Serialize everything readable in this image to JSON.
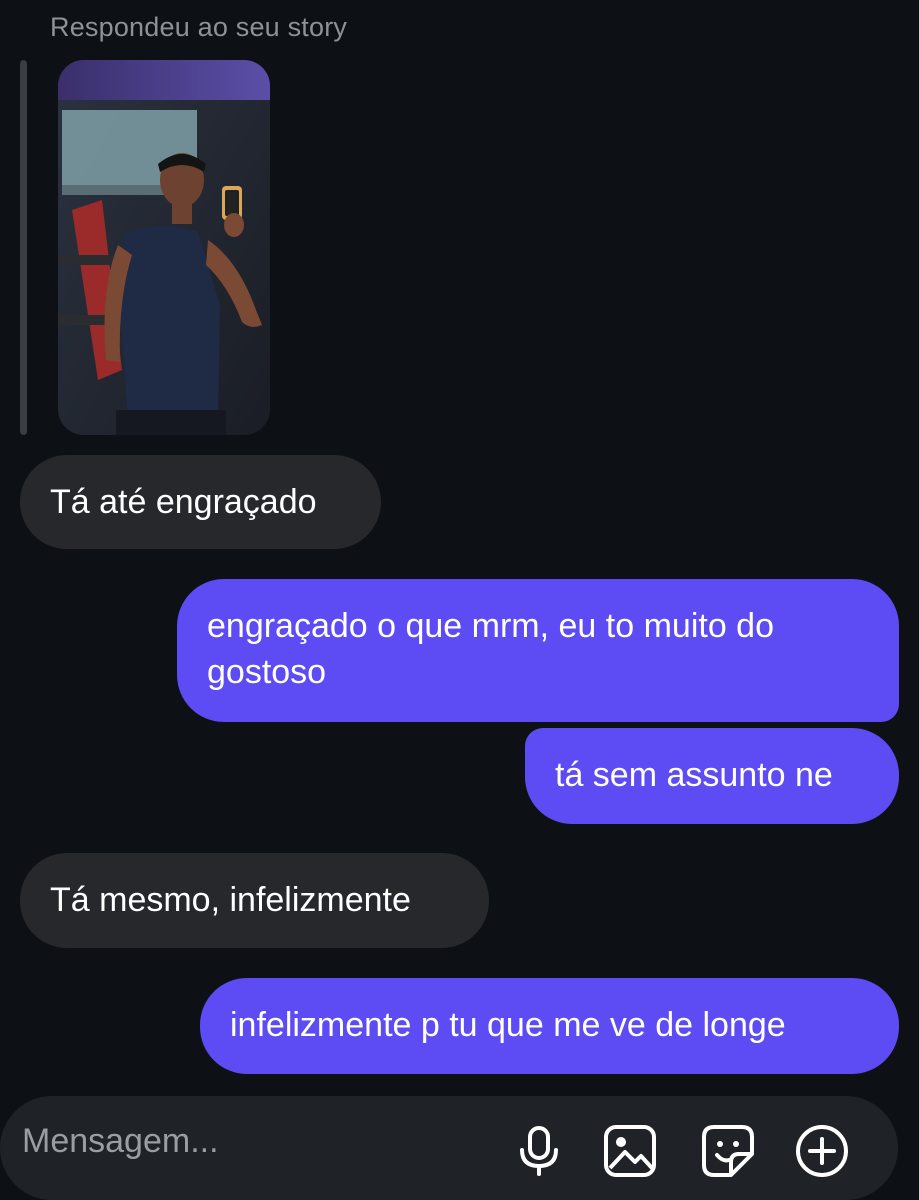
{
  "story_reply": {
    "label": "Respondeu ao seu story"
  },
  "messages": [
    {
      "direction": "received",
      "text": "Tá até engraçado"
    },
    {
      "direction": "sent",
      "text": "engraçado o que mrm, eu to muito do gostoso"
    },
    {
      "direction": "sent",
      "text": "tá sem assunto ne"
    },
    {
      "direction": "received",
      "text": "Tá mesmo, infelizmente"
    },
    {
      "direction": "sent",
      "text": "infelizmente p tu que me ve de longe"
    }
  ],
  "composer": {
    "placeholder": "Mensagem...",
    "icons": [
      "microphone-icon",
      "gallery-icon",
      "sticker-icon",
      "add-icon"
    ]
  },
  "colors": {
    "background": "#0d1115",
    "received_bubble": "#26282c",
    "sent_bubble": "#5d4cf4",
    "muted_text": "#8e9196"
  }
}
